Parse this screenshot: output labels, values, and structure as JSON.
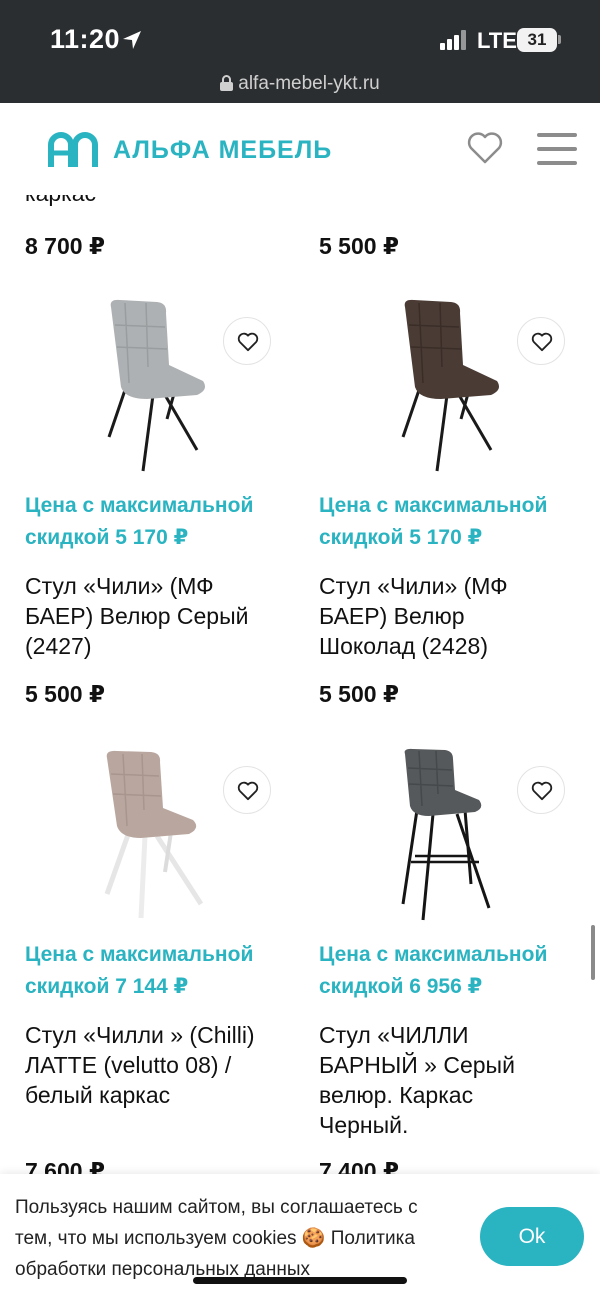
{
  "status_bar": {
    "time": "11:20",
    "network": "LTE",
    "battery": "31"
  },
  "browser": {
    "url": "alfa-mebel-ykt.ru"
  },
  "header": {
    "logo_text": "АЛЬФА МЕБЕЛЬ"
  },
  "top_row": {
    "partial_text": "каркас",
    "prices": [
      "8 700 ₽",
      "5 500 ₽"
    ]
  },
  "products": [
    {
      "promo_line1": "Цена с максимальной",
      "promo_line2": "скидкой 5 170 ₽",
      "title_lines": [
        "Стул «Чили» (МФ",
        "БАЕР) Велюр Серый",
        "(2427)"
      ],
      "price": "5 500 ₽",
      "image": "grey-velour-chair"
    },
    {
      "promo_line1": "Цена с максимальной",
      "promo_line2": "скидкой 5 170 ₽",
      "title_lines": [
        "Стул «Чили» (МФ",
        "БАЕР) Велюр",
        "Шоколад (2428)"
      ],
      "price": "5 500 ₽",
      "image": "chocolate-velour-chair"
    },
    {
      "promo_line1": "Цена с максимальной",
      "promo_line2": "скидкой 7 144 ₽",
      "title_lines": [
        "Стул «Чилли » (Chilli)",
        "ЛАТТЕ (velutto 08) /",
        "белый каркас"
      ],
      "price": "7 600 ₽",
      "image": "latte-chair-white-legs"
    },
    {
      "promo_line1": "Цена с максимальной",
      "promo_line2": "скидкой 6 956 ₽",
      "title_lines": [
        "Стул «ЧИЛЛИ",
        "БАРНЫЙ » Серый",
        "велюр. Каркас",
        "Черный."
      ],
      "price": "7 400 ₽",
      "image": "grey-bar-stool"
    }
  ],
  "cookie_banner": {
    "line1": "Пользуясь нашим сайтом, вы соглашаетесь с",
    "line2": "тем, что мы используем cookies 🍪 Политика",
    "line3": "обработки персональных данных",
    "ok_label": "Ok"
  }
}
